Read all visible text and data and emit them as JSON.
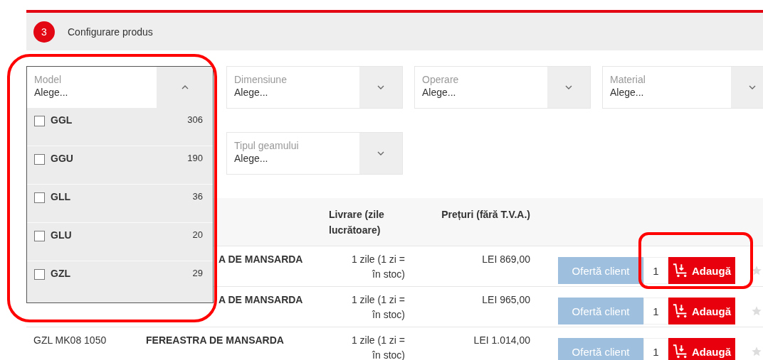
{
  "step": {
    "number": "3",
    "title": "Configurare produs"
  },
  "filters": [
    {
      "label": "Model",
      "value": "Alege...",
      "expanded": true,
      "options": [
        {
          "label": "GGL",
          "count": "306",
          "checked": false
        },
        {
          "label": "GGU",
          "count": "190",
          "checked": false
        },
        {
          "label": "GLL",
          "count": "36",
          "checked": false
        },
        {
          "label": "GLU",
          "count": "20",
          "checked": false
        },
        {
          "label": "GZL",
          "count": "29",
          "checked": false
        }
      ]
    },
    {
      "label": "Dimensiune",
      "value": "Alege...",
      "expanded": false
    },
    {
      "label": "Operare",
      "value": "Alege...",
      "expanded": false
    },
    {
      "label": "Material",
      "value": "Alege...",
      "expanded": false
    },
    {
      "label": "Tipul geamului",
      "value": "Alege...",
      "expanded": false
    }
  ],
  "table": {
    "columns": [
      "Livrare (zile lucrătoare)",
      "Prețuri (fără T.V.A.)"
    ],
    "rows": [
      {
        "name": "A DE MANSARDA",
        "covered": true,
        "delivery": [
          "1 zile (1 zi =",
          "în stoc)"
        ],
        "price": "LEI 869,00",
        "offer": "Ofertă client",
        "quantity": "1",
        "add": "Adaugă"
      },
      {
        "name": "A DE MANSARDA",
        "covered": true,
        "delivery": [
          "1 zile (1 zi =",
          "în stoc)"
        ],
        "price": "LEI 965,00",
        "offer": "Ofertă client",
        "quantity": "1",
        "add": "Adaugă"
      },
      {
        "code": "GZL MK08 1050",
        "name": "FEREASTRA DE MANSARDA",
        "covered": false,
        "delivery": [
          "1 zile (1 zi =",
          "în stoc)"
        ],
        "price": "LEI 1.014,00",
        "offer": "Ofertă client",
        "quantity": "1",
        "add": "Adaugă"
      }
    ]
  }
}
